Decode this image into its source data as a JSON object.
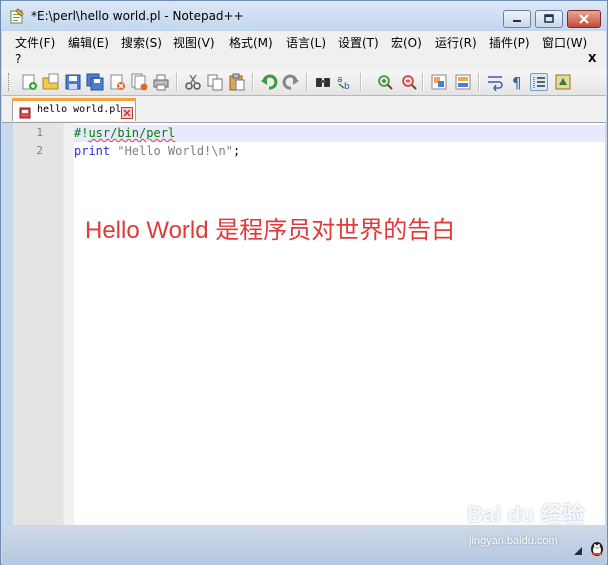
{
  "window": {
    "title": "*E:\\perl\\hello world.pl - Notepad++"
  },
  "menu": {
    "items": [
      {
        "label": "文件(F)"
      },
      {
        "label": "编辑(E)"
      },
      {
        "label": "搜索(S)"
      },
      {
        "label": "视图(V)"
      },
      {
        "label": "格式(M)"
      },
      {
        "label": "语言(L)"
      },
      {
        "label": "设置(T)"
      },
      {
        "label": "宏(O)"
      },
      {
        "label": "运行(R)"
      },
      {
        "label": "插件(P)"
      },
      {
        "label": "窗口(W)"
      }
    ],
    "help": "?",
    "close_glyph": "X"
  },
  "toolbar": {
    "icons": [
      "new-file-icon",
      "open-file-icon",
      "save-icon",
      "save-all-icon",
      "close-icon",
      "close-all-icon",
      "print-icon",
      "cut-icon",
      "copy-icon",
      "paste-icon",
      "undo-icon",
      "redo-icon",
      "find-icon",
      "replace-icon",
      "zoom-in-icon",
      "zoom-out-icon",
      "sync-vertical-icon",
      "sync-horizontal-icon",
      "word-wrap-icon",
      "show-all-chars-icon",
      "indent-guide-icon",
      "user-define-icon"
    ]
  },
  "tab": {
    "label": "hello world.pl"
  },
  "editor": {
    "lines": [
      {
        "number": "1",
        "shebang": "#!",
        "path": "usr/bin/perl"
      },
      {
        "number": "2",
        "keyword": "print",
        "string": "\"Hello World!\\n\"",
        "end": ";"
      }
    ],
    "overlay": "Hello World 是程序员对世界的告白"
  },
  "watermark": {
    "logo": "Bai du 经验",
    "url": "jingyan.baidu.com"
  },
  "colors": {
    "overlay": "#e03a3a",
    "keyword": "#2a2ae0",
    "string": "#808080",
    "tab_accent": "#f6a33b"
  }
}
